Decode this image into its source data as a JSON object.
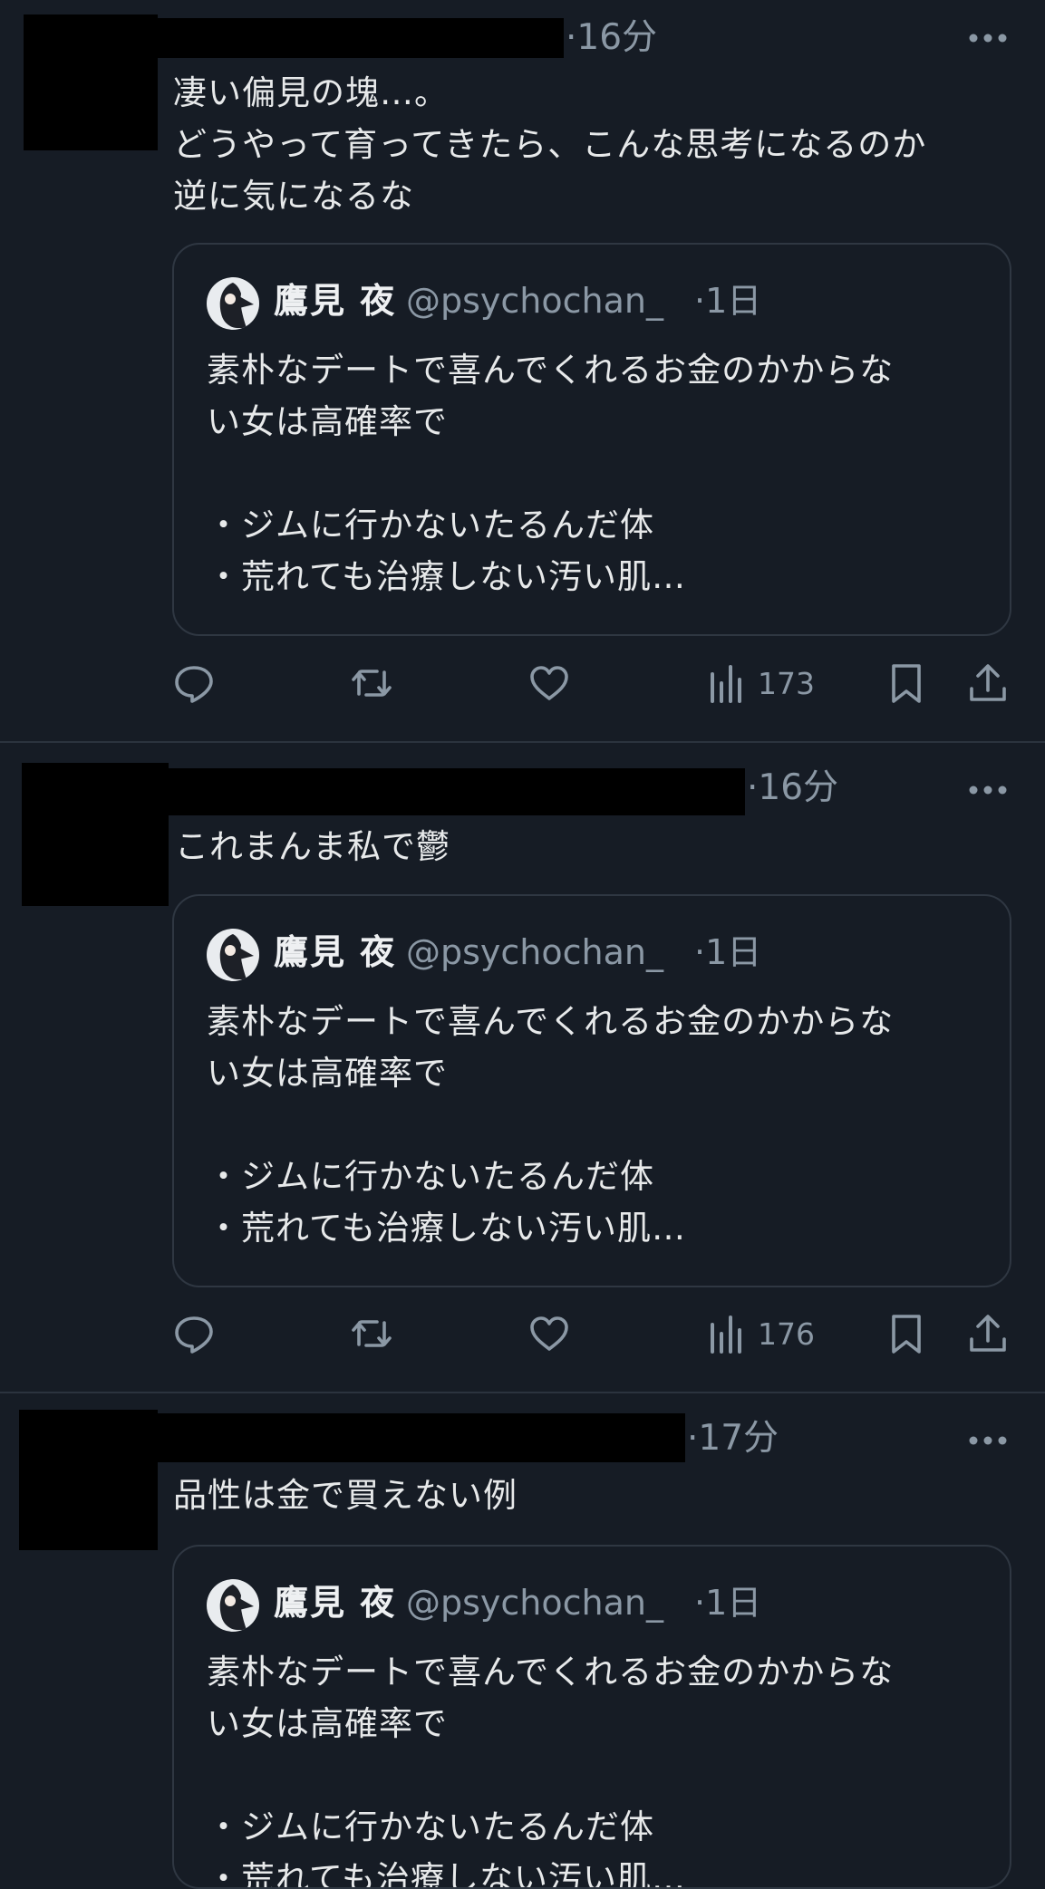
{
  "tweets": [
    {
      "time": "·16分",
      "text": "凄い偏見の塊…。\nどうやって育ってきたら、こんな思考になるのか\n逆に気になるな",
      "views": "173"
    },
    {
      "time": "·16分",
      "text": "これまんま私で鬱",
      "views": "176"
    },
    {
      "time": "·17分",
      "text": "品性は金で買えない例",
      "views": ""
    }
  ],
  "quoted": {
    "name": "鷹見 夜",
    "handle": "@psychochan_",
    "time": "·1日",
    "text": "素朴なデートで喜んでくれるお金のかからな\nい女は高確率で\n\n・ジムに行かないたるんだ体\n・荒れても治療しない汚い肌…"
  },
  "icons": {
    "more": "more-horizontal-icon",
    "reply": "reply-icon",
    "retweet": "retweet-icon",
    "like": "like-icon",
    "views": "views-icon",
    "bookmark": "bookmark-icon",
    "share": "share-icon"
  },
  "colors": {
    "background": "#161c25",
    "text": "#e7e9ea",
    "secondary": "#8b98a5",
    "border": "#2f3742"
  }
}
